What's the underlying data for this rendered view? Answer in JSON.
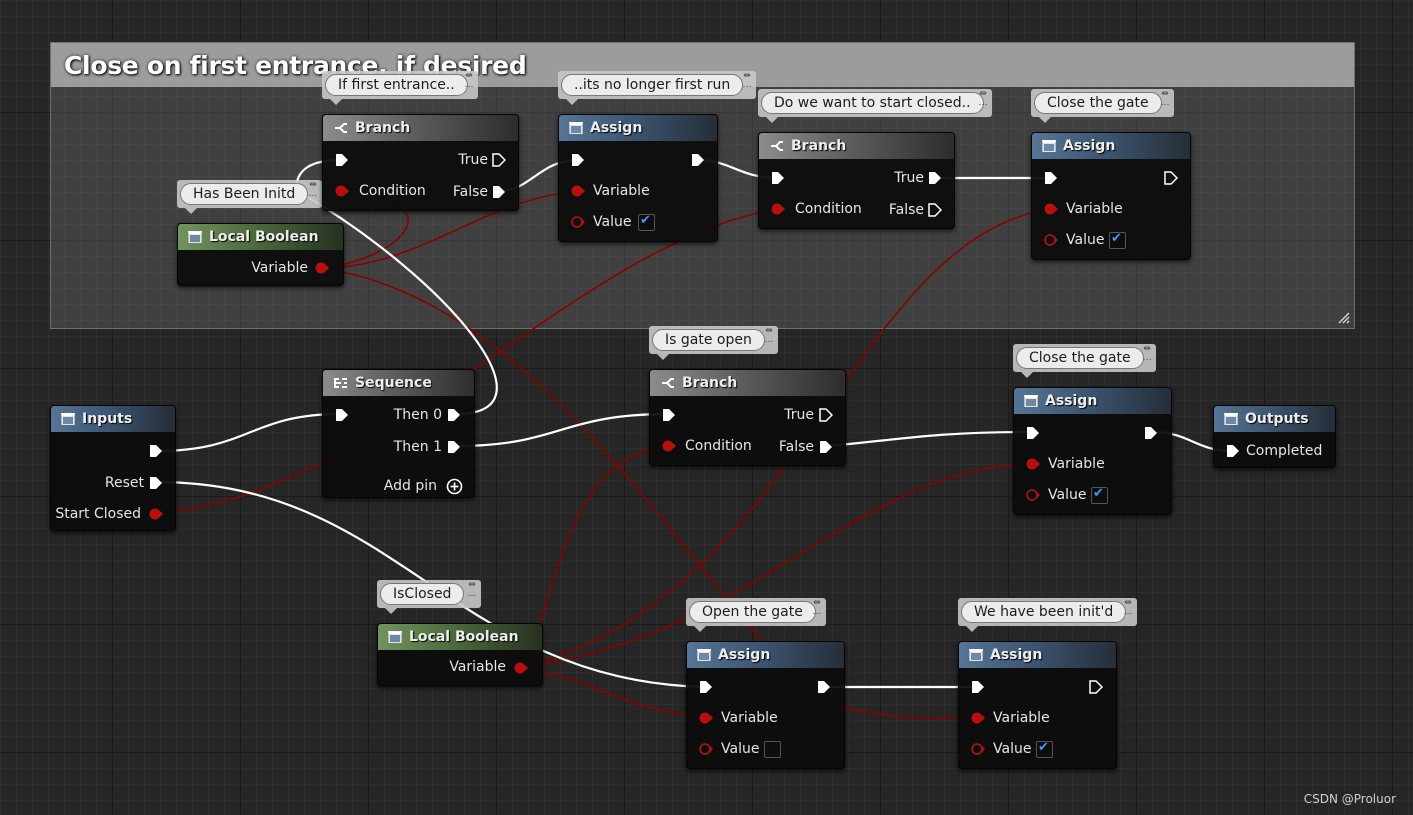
{
  "comment": {
    "title": "Close on first entrance, if desired"
  },
  "nodes": {
    "branch_first": {
      "title": "Branch",
      "true_label": "True",
      "condition_label": "Condition",
      "false_label": "False"
    },
    "assign_first": {
      "title": "Assign",
      "variable_label": "Variable",
      "value_label": "Value",
      "value_checked": true
    },
    "branch_closed": {
      "title": "Branch",
      "true_label": "True",
      "condition_label": "Condition",
      "false_label": "False"
    },
    "assign_close1": {
      "title": "Assign",
      "variable_label": "Variable",
      "value_label": "Value",
      "value_checked": true
    },
    "local_initd": {
      "title": "Local Boolean",
      "variable_label": "Variable"
    },
    "inputs": {
      "title": "Inputs",
      "reset_label": "Reset",
      "start_closed_label": "Start Closed"
    },
    "sequence": {
      "title": "Sequence",
      "then0_label": "Then 0",
      "then1_label": "Then 1",
      "add_pin_label": "Add pin"
    },
    "branch_gate": {
      "title": "Branch",
      "true_label": "True",
      "condition_label": "Condition",
      "false_label": "False"
    },
    "assign_close2": {
      "title": "Assign",
      "variable_label": "Variable",
      "value_label": "Value",
      "value_checked": true
    },
    "outputs": {
      "title": "Outputs",
      "completed_label": "Completed"
    },
    "local_closed": {
      "title": "Local Boolean",
      "variable_label": "Variable"
    },
    "assign_open": {
      "title": "Assign",
      "variable_label": "Variable",
      "value_label": "Value",
      "value_checked": false
    },
    "assign_initd": {
      "title": "Assign",
      "variable_label": "Variable",
      "value_label": "Value",
      "value_checked": true
    }
  },
  "bubbles": {
    "if_first": "If first entrance..",
    "no_longer_first": "..its no longer first run",
    "start_closed": "Do we want to start closed..",
    "close_gate1": "Close the gate",
    "has_been_initd": "Has Been Initd",
    "is_gate_open": "Is gate open",
    "close_gate2": "Close the gate",
    "is_closed": "IsClosed",
    "open_gate": "Open the gate",
    "been_initd": "We have been init'd"
  },
  "watermark": "CSDN @Proluor",
  "colors": {
    "exec_wire": "#ffffff",
    "bool_wire": "#8b0000",
    "bool_pin": "#b80f0f",
    "check": "#3d9bff"
  }
}
